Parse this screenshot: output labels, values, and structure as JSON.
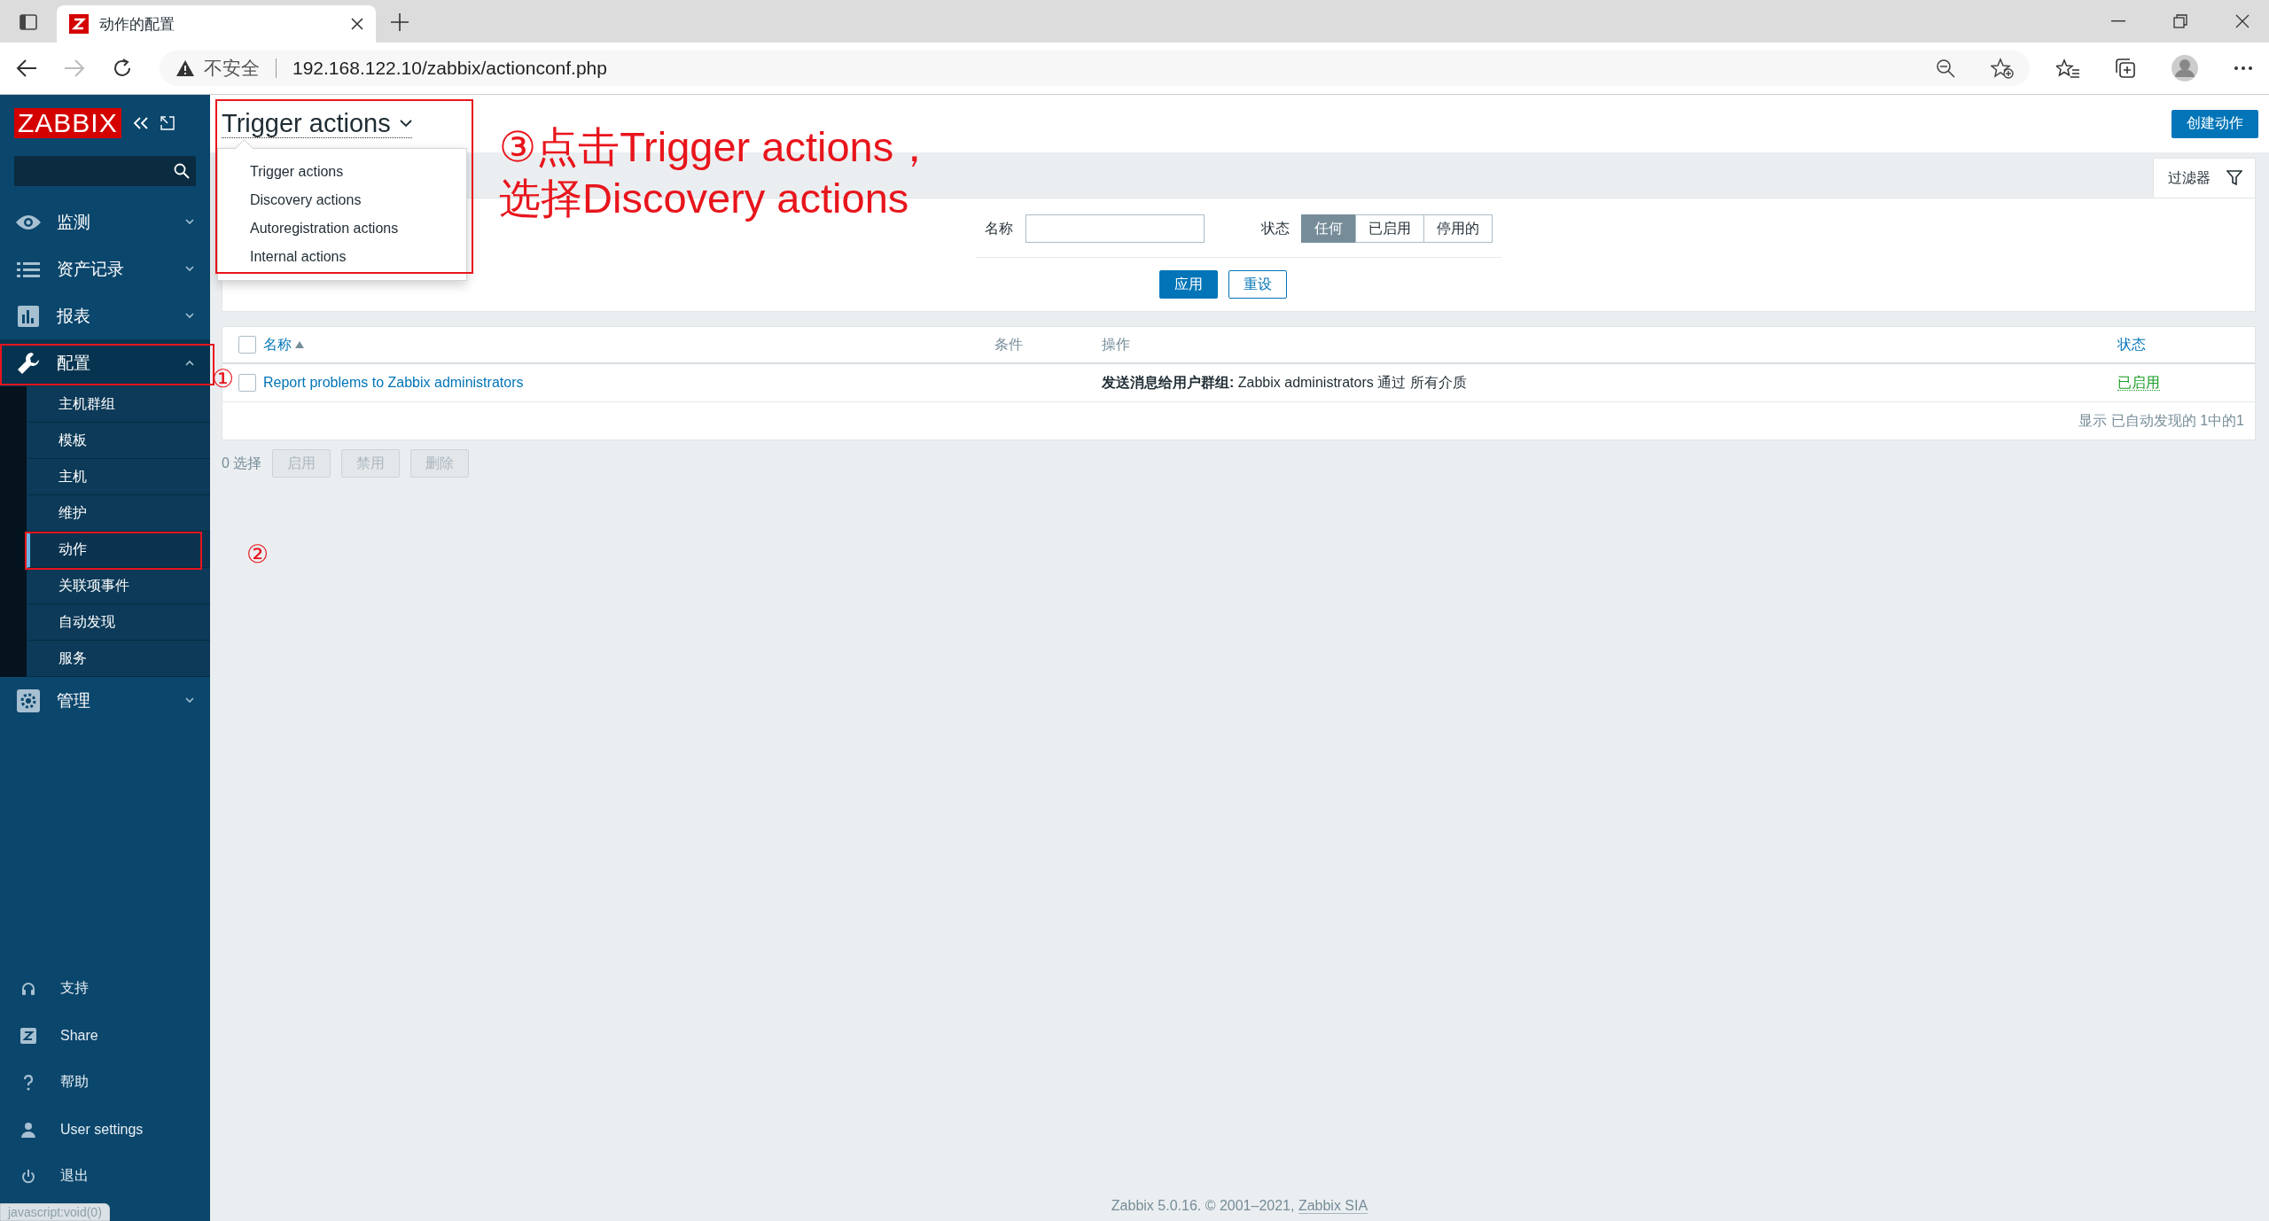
{
  "browser": {
    "tab_title": "动作的配置",
    "security": "不安全",
    "url": "192.168.122.10/zabbix/actionconf.php"
  },
  "sidebar": {
    "logo": "ZABBIX",
    "menu": [
      {
        "label": "监测",
        "expanded": false
      },
      {
        "label": "资产记录",
        "expanded": false
      },
      {
        "label": "报表",
        "expanded": false
      },
      {
        "label": "配置",
        "expanded": true,
        "children": [
          {
            "label": "主机群组",
            "selected": false
          },
          {
            "label": "模板",
            "selected": false
          },
          {
            "label": "主机",
            "selected": false
          },
          {
            "label": "维护",
            "selected": false
          },
          {
            "label": "动作",
            "selected": true
          },
          {
            "label": "关联项事件",
            "selected": false
          },
          {
            "label": "自动发现",
            "selected": false
          },
          {
            "label": "服务",
            "selected": false
          }
        ]
      },
      {
        "label": "管理",
        "expanded": false
      }
    ],
    "bottom_items": [
      {
        "label": "支持"
      },
      {
        "label": "Share"
      },
      {
        "label": "帮助"
      },
      {
        "label": "User settings"
      },
      {
        "label": "退出"
      }
    ]
  },
  "status_link": "javascript:void(0)",
  "header": {
    "title": "Trigger actions",
    "dropdown": [
      "Trigger actions",
      "Discovery actions",
      "Autoregistration actions",
      "Internal actions"
    ],
    "create_button": "创建动作"
  },
  "filter": {
    "tab_label": "过滤器",
    "name_label": "名称",
    "status_label": "状态",
    "status_options": [
      {
        "label": "任何",
        "selected": true
      },
      {
        "label": "已启用",
        "selected": false
      },
      {
        "label": "停用的",
        "selected": false
      }
    ],
    "apply": "应用",
    "reset": "重设"
  },
  "table": {
    "select_all_checked": false,
    "columns": [
      {
        "label": "名称",
        "sortable": true,
        "sorted": true
      },
      {
        "label": "条件",
        "sortable": false,
        "sorted": false
      },
      {
        "label": "操作",
        "sortable": false,
        "sorted": false
      },
      {
        "label": "状态",
        "sortable": true,
        "sorted": false
      }
    ],
    "rows": [
      {
        "checked": false,
        "name": "Report problems to Zabbix administrators",
        "operation": "**发送消息给用户群组:** Zabbix administrators 通过 所有介质",
        "status": "已启用"
      }
    ],
    "summary": "显示 已自动发现的 1中的1"
  },
  "mass_actions": {
    "selected_count": "0 选择",
    "buttons": [
      {
        "label": "启用",
        "disabled": true
      },
      {
        "label": "禁用",
        "disabled": true
      },
      {
        "label": "删除",
        "disabled": true
      }
    ]
  },
  "footer": {
    "text": "Zabbix 5.0.16. © 2001–2021, ",
    "link": "Zabbix SIA"
  },
  "annotations": {
    "instruction": [
      "③点击Trigger actions，",
      "选择Discovery actions"
    ],
    "markers": [
      "①",
      "②"
    ]
  }
}
